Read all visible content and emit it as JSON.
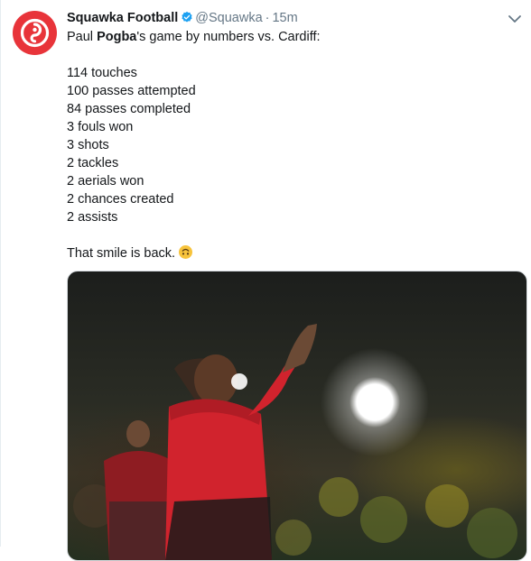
{
  "tweet": {
    "author_name": "Squawka Football",
    "handle": "@Squawka",
    "separator": "·",
    "time": "15m",
    "line1_pre": "Paul ",
    "line1_bold": "Pogba",
    "line1_post": "'s game by numbers vs. Cardiff:",
    "stats": [
      "114 touches",
      "100 passes attempted",
      "84 passes completed",
      "3 fouls won",
      "3 shots",
      "2 tackles",
      "2 aerials won",
      "2 chances created",
      "2 assists"
    ],
    "closing": "That smile is back."
  },
  "icons": {
    "avatar": "squawka-logo",
    "verified": "verified-badge-icon",
    "menu": "chevron-down-icon",
    "emoji": "upside-down-face-emoji"
  },
  "colors": {
    "brand_red": "#e8343a",
    "verified_blue": "#1da1f2",
    "secondary_text": "#657786"
  }
}
